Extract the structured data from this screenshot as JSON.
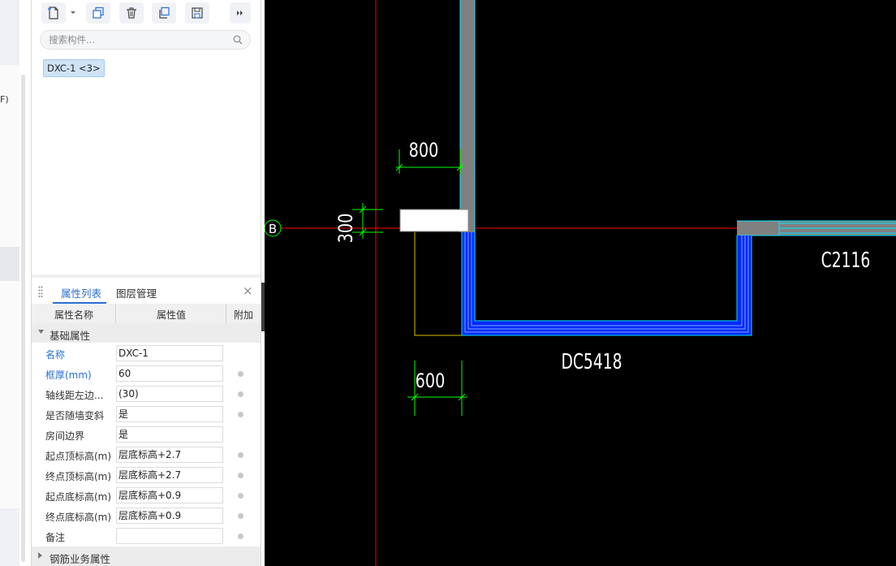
{
  "left_edge": {
    "partial_text": "F)"
  },
  "toolbar": {
    "buttons": [
      {
        "name": "new-component-button",
        "icon": "new-file-icon"
      },
      {
        "name": "new-dropdown-button",
        "icon": "dropdown-arrow-icon"
      },
      {
        "name": "copy-button",
        "icon": "copy-icon"
      },
      {
        "name": "delete-button",
        "icon": "trash-icon"
      },
      {
        "name": "duplicate-to-layer-button",
        "icon": "duplicate-icon"
      },
      {
        "name": "save-template-button",
        "icon": "save-icon"
      },
      {
        "name": "more-button",
        "icon": "double-chevron-right-icon"
      }
    ]
  },
  "search": {
    "placeholder": "搜索构件..."
  },
  "component_tag": "DXC-1 <3>",
  "tabs": {
    "properties": "属性列表",
    "layers": "图层管理",
    "close": "×"
  },
  "table": {
    "headers": {
      "name": "属性名称",
      "value": "属性值",
      "extra": "附加"
    },
    "section_basic": "基础属性",
    "rows": [
      {
        "name": "名称",
        "value": "DXC-1"
      },
      {
        "name": "框厚(mm)",
        "value": "60"
      },
      {
        "name": "轴线距左边...",
        "value": "(30)"
      },
      {
        "name": "是否随墙变斜",
        "value": "是"
      },
      {
        "name": "房间边界",
        "value": "是"
      },
      {
        "name": "起点顶标高(m)",
        "value": "层底标高+2.7"
      },
      {
        "name": "终点顶标高(m)",
        "value": "层底标高+2.7"
      },
      {
        "name": "起点底标高(m)",
        "value": "层底标高+0.9"
      },
      {
        "name": "终点底标高(m)",
        "value": "层底标高+0.9"
      },
      {
        "name": "备注",
        "value": ""
      }
    ],
    "section_rebar": "钢筋业务属性"
  },
  "cad": {
    "axis_label": "B",
    "dims": {
      "top": "800",
      "left": "300",
      "bottom": "600"
    },
    "labels": {
      "window_right": "C2116",
      "window_bottom": "DC5418"
    },
    "colors": {
      "background": "#000000",
      "axis": "#ff0000",
      "dimension": "#00ff00",
      "wall": "#808080",
      "window": "#0000ff",
      "text": "#ffffff"
    }
  }
}
